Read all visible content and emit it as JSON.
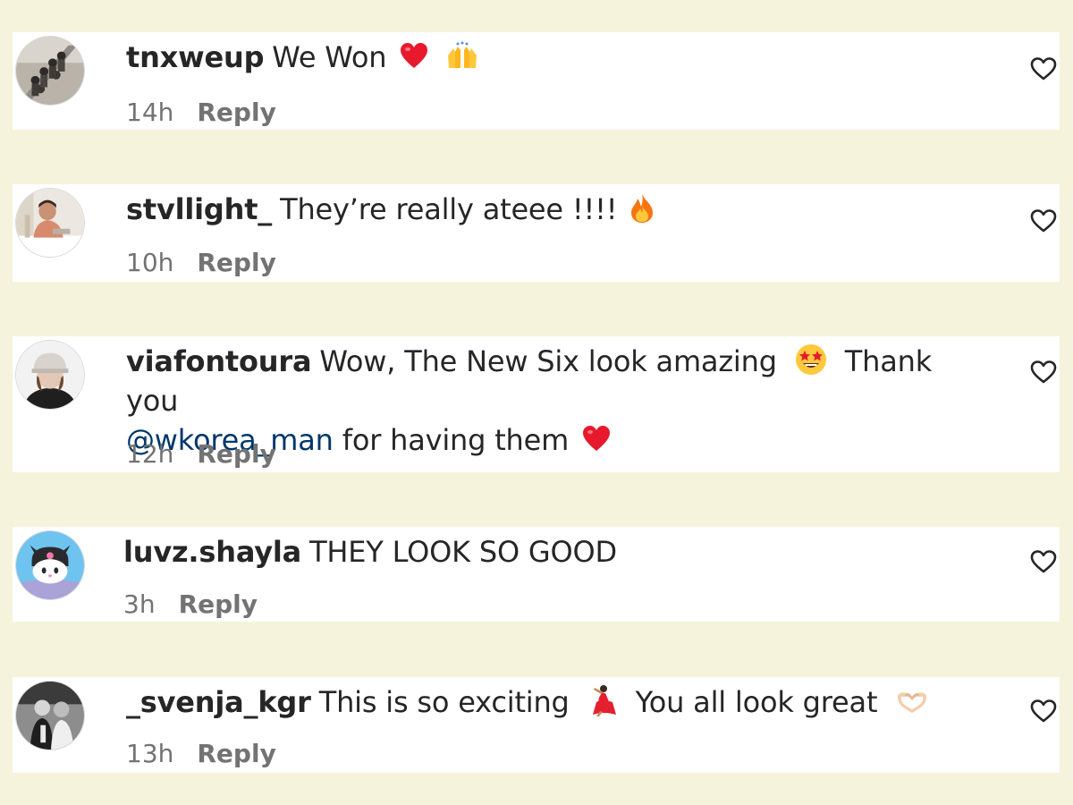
{
  "comments": [
    {
      "avatar_icon": "avatar-group-photo",
      "username": "tnxweup",
      "text_1": "We Won",
      "emoji_1": "red-heart-emoji",
      "emoji_2": "raising-hands-emoji",
      "time": "14h",
      "reply_label": "Reply",
      "like_icon": "heart-outline-icon"
    },
    {
      "avatar_icon": "avatar-person-desk",
      "username": "stvllight_",
      "text_1": "They’re really ateee !!!!",
      "emoji_1": "fire-emoji",
      "time": "10h",
      "reply_label": "Reply",
      "like_icon": "heart-outline-icon"
    },
    {
      "avatar_icon": "avatar-person-hat",
      "username": "viafontoura",
      "text_1": "Wow, The New Six look amazing",
      "emoji_1": "star-struck-emoji",
      "text_2": "Thank you",
      "mention": "@wkorea_man",
      "text_3": "for having them",
      "emoji_2": "red-heart-emoji",
      "time": "12h",
      "reply_label": "Reply",
      "like_icon": "heart-outline-icon"
    },
    {
      "avatar_icon": "avatar-kuromi",
      "username": "luvz.shayla",
      "text_1": "THEY LOOK SO GOOD",
      "time": "3h",
      "reply_label": "Reply",
      "like_icon": "heart-outline-icon"
    },
    {
      "avatar_icon": "avatar-bw-photo",
      "username": "_svenja_kgr",
      "text_1": "This is so exciting",
      "emoji_1": "dancer-emoji",
      "text_2": "You all look great",
      "emoji_2": "heart-hands-emoji",
      "time": "13h",
      "reply_label": "Reply",
      "like_icon": "heart-outline-icon"
    }
  ],
  "colors": {
    "page_background": "#f5f3dc",
    "card_background": "#ffffff",
    "text": "#262626",
    "secondary_text": "#737373",
    "mention": "#00376b"
  }
}
